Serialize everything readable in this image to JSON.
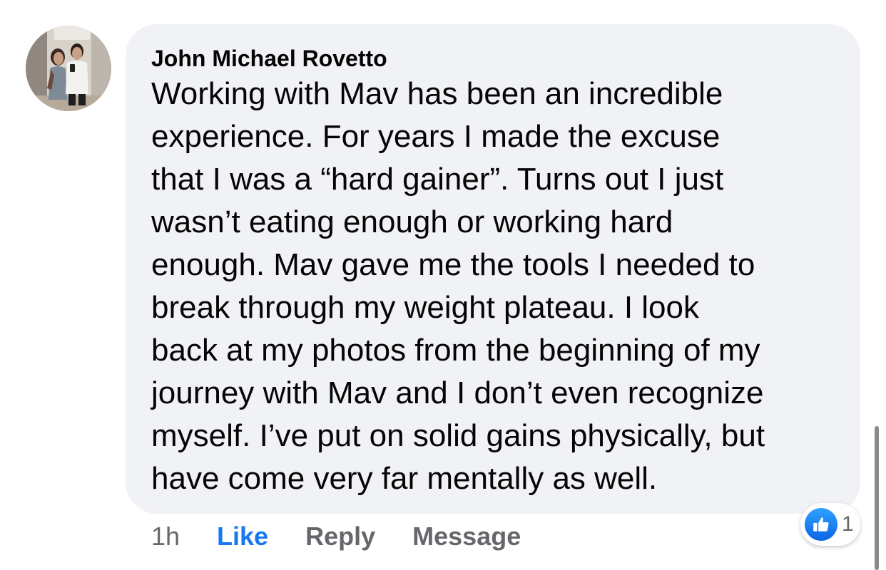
{
  "comment": {
    "author": "John Michael Rovetto",
    "lines": [
      "Working with Mav has been an incredible",
      "experience. For years I made the excuse",
      "that I was a “hard gainer”. Turns out I just",
      "wasn’t eating enough or working hard",
      "enough. Mav gave me the tools I needed to",
      "break through my weight plateau. I look",
      "back at my photos from the beginning of my",
      "journey with Mav and I don’t even recognize",
      "myself. I’ve put on solid gains physically, but",
      "have come very far mentally as well."
    ]
  },
  "actions": {
    "time": "1h",
    "like": "Like",
    "reply": "Reply",
    "message": "Message"
  },
  "reactions": {
    "icon": "thumbs-up-icon",
    "count": "1"
  },
  "colors": {
    "bubble": "#f0f2f5",
    "like_blue": "#1877f2",
    "meta_gray": "#65676b"
  }
}
